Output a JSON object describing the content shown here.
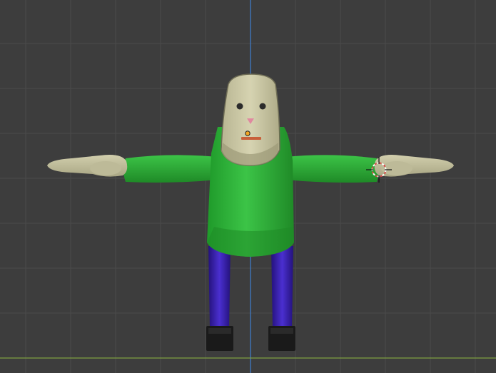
{
  "viewport": {
    "view": "front-orthographic",
    "colors": {
      "background": "#3d3d3d",
      "grid_minor": "#4a4a4a",
      "axis_z": "#3f7fd0",
      "axis_x": "#7fa043",
      "skin": "#cbc8a6",
      "skin_shadow": "#a9a684",
      "shirt": "#2fb43a",
      "shirt_dark": "#1f8a27",
      "pants": "#3a1fb8",
      "pants_dark": "#24127c",
      "shoes": "#1a1a1a",
      "origin_dot": "#f2a623",
      "cursor_red": "#d84a4a"
    },
    "icons": [
      "3d-cursor-icon",
      "origin-point-icon"
    ]
  }
}
